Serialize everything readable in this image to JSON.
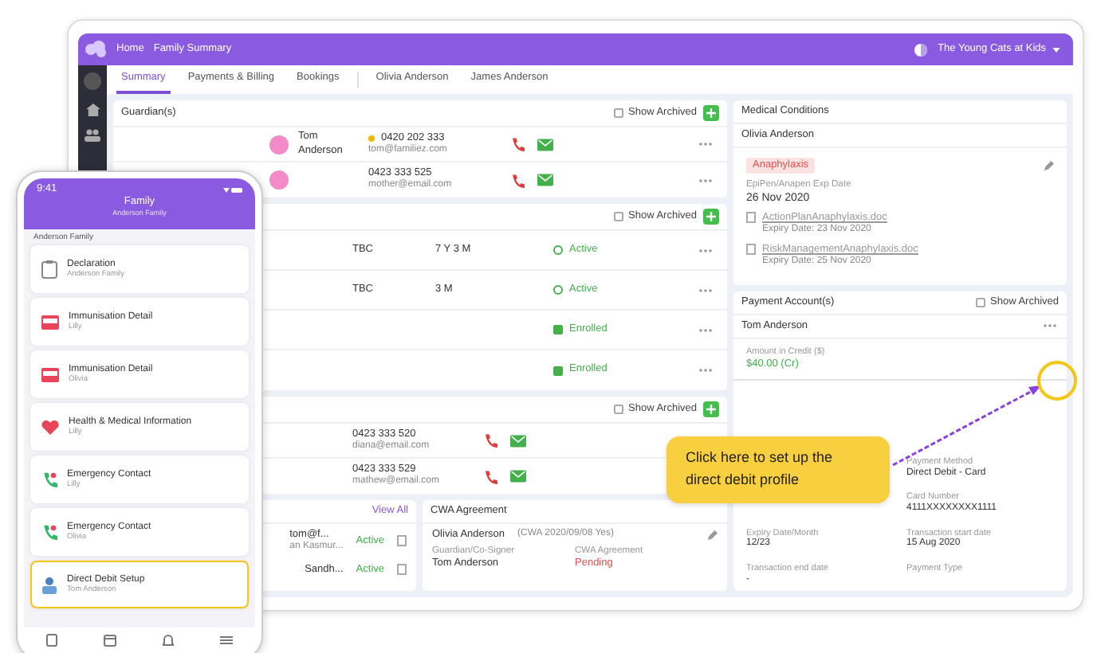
{
  "header": {
    "breadcrumb": [
      "Home",
      "Family Summary"
    ],
    "account": "The Young Cats at Kids"
  },
  "tabs": [
    {
      "label": "Summary",
      "separator_before": false,
      "selected": true
    },
    {
      "label": "Payments & Billing",
      "separator_before": false,
      "selected": false
    },
    {
      "label": "Bookings",
      "separator_before": false,
      "selected": false
    },
    {
      "label": "Olivia Anderson",
      "separator_before": true,
      "selected": false
    },
    {
      "label": "James Anderson",
      "separator_before": false,
      "selected": false
    }
  ],
  "guardians": {
    "title": "Guardian(s)",
    "show_archived": {
      "label": "Show Archived",
      "checked": false
    },
    "rows": [
      {
        "name": "Tom Anderson",
        "primary": true,
        "phone": "0420 202 333",
        "email": "tom@familiez.com"
      },
      {
        "primary": false,
        "phone": "0423 333 525",
        "email": "mother@email.com"
      }
    ]
  },
  "children": {
    "show_archived": {
      "label": "Show Archived",
      "checked": false
    },
    "rows": [
      {
        "code": "TBC",
        "age": "7 Y 3 M",
        "status": {
          "label": "Active",
          "kind": "active"
        }
      },
      {
        "code": "TBC",
        "age": "3 M",
        "status": {
          "label": "Active",
          "kind": "active"
        }
      },
      {
        "status": {
          "label": "Enrolled",
          "kind": "enrolled"
        }
      },
      {
        "status": {
          "label": "Enrolled",
          "kind": "enrolled"
        }
      }
    ]
  },
  "contacts": {
    "show_archived": {
      "label": "Show Archived",
      "checked": false
    },
    "rows": [
      {
        "phone": "0423 333 520",
        "email": "diana@email.com"
      },
      {
        "phone": "0423 333 529",
        "email": "mathew@email.com"
      }
    ]
  },
  "enrolments": {
    "link": "View All",
    "rows": [
      {
        "text": "tom@f...",
        "subtext": "an Kasmur...",
        "status": "Active"
      },
      {
        "text": "Sandh...",
        "status": "Active"
      }
    ]
  },
  "cwa": {
    "title": "CWA Agreement",
    "child": "Olivia Anderson",
    "note": "(CWA 2020/09/08 Yes)",
    "fields": [
      {
        "label": "Guardian/Co-Signer",
        "value": "Tom Anderson",
        "kind": "plain"
      },
      {
        "label": "CWA Agreement",
        "value": "Pending",
        "kind": "pending"
      }
    ]
  },
  "medical": {
    "title": "Medical Conditions",
    "child": "Olivia Anderson",
    "condition": "Anaphylaxis",
    "exp_label": "EpiPen/Anapen Exp Date",
    "exp_value": "26 Nov 2020",
    "documents": [
      {
        "name": "ActionPlanAnaphylaxis.doc",
        "expiry": "Expiry Date: 23 Nov 2020"
      },
      {
        "name": "RiskManagementAnaphylaxis.doc",
        "expiry": "Expiry Date: 25 Nov 2020"
      }
    ]
  },
  "payments": {
    "title": "Payment Account(s)",
    "show_archived": {
      "label": "Show Archived",
      "checked": false
    },
    "account": "Tom Anderson",
    "credit": {
      "label": "Amount in Credit ($)",
      "value": "$40.00 (Cr)"
    },
    "fields": [
      {
        "label": "Payment Method",
        "value": "Direct Debit - Card"
      },
      {
        "label": "Card Number",
        "value": "4111XXXXXXXX1111"
      },
      {
        "label": "Expiry Date/Month",
        "value": "12/23"
      },
      {
        "label": "Transaction start date",
        "value": "15 Aug 2020"
      },
      {
        "label": "Transaction end date",
        "value": "-"
      },
      {
        "label": "Payment Type"
      }
    ]
  },
  "callout": "Click here to set up the direct debit profile",
  "phone": {
    "time": "9:41",
    "title": "Family",
    "subtitle": "Anderson Family",
    "section": "Anderson Family",
    "items": [
      {
        "title": "Declaration",
        "subtitle": "Anderson Family",
        "kind": "declaration",
        "highlighted": false
      },
      {
        "title": "Immunisation Detail",
        "subtitle": "Lilly",
        "kind": "immunisation",
        "highlighted": false
      },
      {
        "title": "Immunisation Detail",
        "subtitle": "Olivia",
        "kind": "immunisation",
        "highlighted": false
      },
      {
        "title": "Health & Medical Information",
        "subtitle": "Lilly",
        "kind": "health",
        "highlighted": false
      },
      {
        "title": "Emergency Contact",
        "subtitle": "Lilly",
        "kind": "contact",
        "highlighted": false
      },
      {
        "title": "Emergency Contact",
        "subtitle": "Olivia",
        "kind": "contact",
        "highlighted": false
      },
      {
        "title": "Direct Debit Setup",
        "subtitle": "Tom Anderson",
        "kind": "payment",
        "highlighted": true
      }
    ]
  }
}
